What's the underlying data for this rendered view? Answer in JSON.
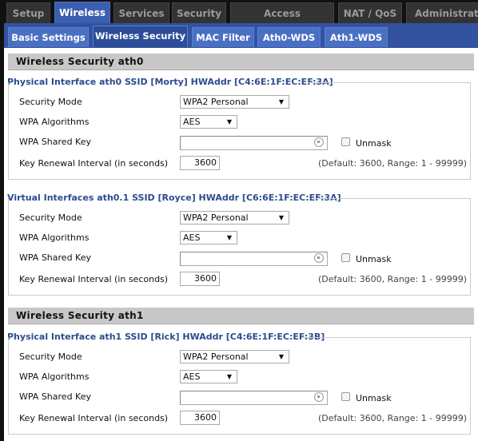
{
  "main_tabs": [
    {
      "label": "Setup",
      "active": false
    },
    {
      "label": "Wireless",
      "active": true
    },
    {
      "label": "Services",
      "active": false
    },
    {
      "label": "Security",
      "active": false
    },
    {
      "label": "Access Restrictions",
      "active": false
    },
    {
      "label": "NAT / QoS",
      "active": false
    },
    {
      "label": "Administration",
      "active": false
    }
  ],
  "sub_tabs": [
    {
      "label": "Basic Settings",
      "active": false
    },
    {
      "label": "Wireless Security",
      "active": true
    },
    {
      "label": "MAC Filter",
      "active": false
    },
    {
      "label": "Ath0-WDS",
      "active": false
    },
    {
      "label": "Ath1-WDS",
      "active": false
    }
  ],
  "sections": [
    {
      "title": "Wireless Security ath0",
      "interfaces": [
        {
          "legend": "Physical Interface ath0 SSID [Morty] HWAddr [C4:6E:1F:EC:EF:3A]",
          "security_mode_label": "Security Mode",
          "security_mode": "WPA2 Personal",
          "wpa_algorithms_label": "WPA Algorithms",
          "wpa_algorithms": "AES",
          "shared_key_label": "WPA Shared Key",
          "shared_key": "",
          "unmask_label": "Unmask",
          "renewal_label": "Key Renewal Interval (in seconds)",
          "renewal": "3600",
          "renewal_hint": "(Default: 3600, Range: 1 - 99999)"
        },
        {
          "legend": "Virtual Interfaces ath0.1 SSID [Royce] HWAddr [C6:6E:1F:EC:EF:3A]",
          "security_mode_label": "Security Mode",
          "security_mode": "WPA2 Personal",
          "wpa_algorithms_label": "WPA Algorithms",
          "wpa_algorithms": "AES",
          "shared_key_label": "WPA Shared Key",
          "shared_key": "",
          "unmask_label": "Unmask",
          "renewal_label": "Key Renewal Interval (in seconds)",
          "renewal": "3600",
          "renewal_hint": "(Default: 3600, Range: 1 - 99999)"
        }
      ]
    },
    {
      "title": "Wireless Security ath1",
      "interfaces": [
        {
          "legend": "Physical Interface ath1 SSID [Rick] HWAddr [C4:6E:1F:EC:EF:3B]",
          "security_mode_label": "Security Mode",
          "security_mode": "WPA2 Personal",
          "wpa_algorithms_label": "WPA Algorithms",
          "wpa_algorithms": "AES",
          "shared_key_label": "WPA Shared Key",
          "shared_key": "",
          "unmask_label": "Unmask",
          "renewal_label": "Key Renewal Interval (in seconds)",
          "renewal": "3600",
          "renewal_hint": "(Default: 3600, Range: 1 - 99999)"
        }
      ]
    }
  ],
  "colors": {
    "accent": "#3b5fae",
    "legend": "#2d4b8e",
    "header_bg": "#c8c8c8"
  }
}
